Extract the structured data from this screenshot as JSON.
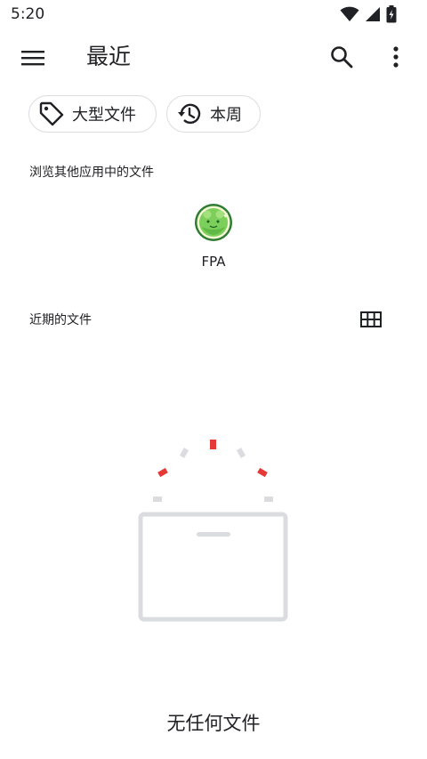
{
  "status_bar": {
    "time": "5:20",
    "icons": [
      "wifi-icon",
      "signal-icon",
      "battery-charging-icon"
    ]
  },
  "app_bar": {
    "title": "最近",
    "menu_icon": "menu-icon",
    "search_icon": "search-icon",
    "more_icon": "more-vert-icon"
  },
  "chips": [
    {
      "label": "大型文件",
      "icon": "tag-icon"
    },
    {
      "label": "本周",
      "icon": "history-icon"
    }
  ],
  "browse_section": {
    "title": "浏览其他应用中的文件",
    "apps": [
      {
        "label": "FPA",
        "icon": "fpa-app-icon"
      }
    ]
  },
  "recent_section": {
    "title": "近期的文件",
    "view_toggle_icon": "grid-view-icon"
  },
  "empty_state": {
    "message": "无任何文件",
    "accent_color": "#e53935",
    "neutral_color": "#dadce0"
  }
}
